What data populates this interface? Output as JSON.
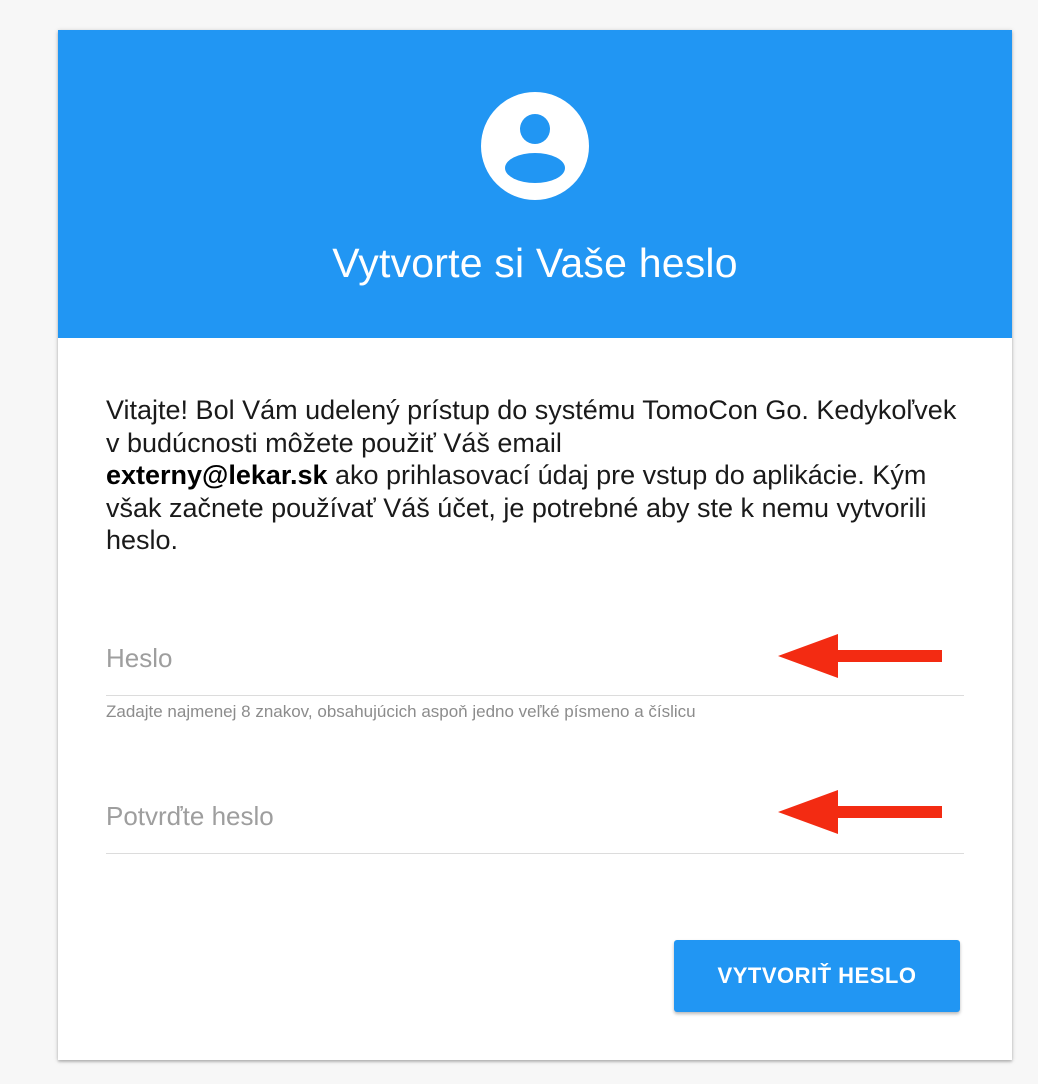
{
  "header": {
    "avatar_icon": "account-circle-icon",
    "title": "Vytvorte si Vaše heslo",
    "background_color": "#2196f3"
  },
  "intro": {
    "before_email": "Vitajte! Bol Vám udelený prístup do systému TomoCon Go. Kedykoľvek v budúcnosti môžete použiť Váš email",
    "email": "externy@lekar.sk",
    "after_email": "ako prihlasovací údaj pre vstup do aplikácie. Kým však začnete používať Váš účet, je potrebné aby ste k nemu vytvorili heslo."
  },
  "form": {
    "password": {
      "placeholder": "Heslo",
      "value": "",
      "hint": "Zadajte najmenej 8 znakov, obsahujúcich aspoň jedno veľké písmeno a číslicu"
    },
    "confirm_password": {
      "placeholder": "Potvrďte heslo",
      "value": ""
    },
    "submit_label": "VYTVORIŤ HESLO"
  },
  "annotations": {
    "arrow_icon": "red-arrow-left-icon",
    "arrow_color": "#f32b12"
  }
}
